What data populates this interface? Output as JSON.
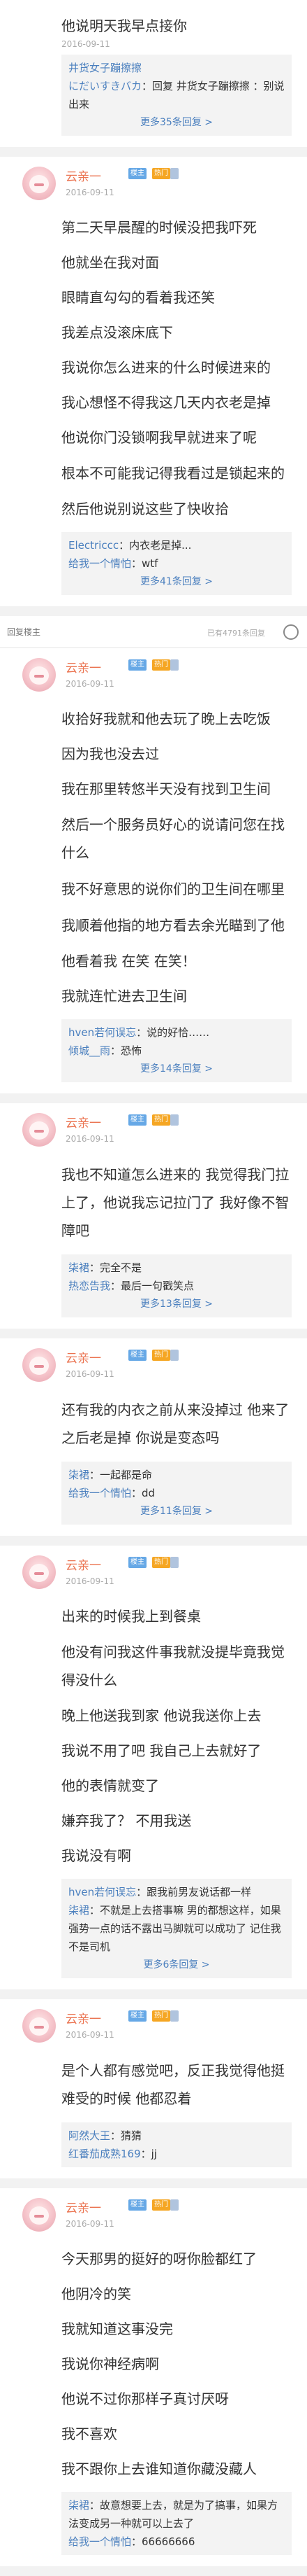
{
  "top": {
    "lines": [
      "他说明天我早点接你"
    ],
    "replies": [
      {
        "name": "井货女子蹦擦擦",
        "text": ""
      },
      {
        "name": "にだいすきバカ",
        "text": "：回复 井货女子蹦擦擦 ：别说出来"
      }
    ],
    "more": "更多35条回复 >"
  },
  "posts": [
    {
      "floor": "",
      "user": "云亲一",
      "badge1": "楼主",
      "badge2": "热门",
      "date": "2016-09-11",
      "lines": [
        "第二天早晨醒的时候没把我吓死",
        "他就坐在我对面",
        "眼睛直勾勾的看着我还笑",
        "我差点没滚床底下",
        "我说你怎么进来的什么时候进来的",
        "我心想怪不得我这几天内衣老是掉",
        "他说你门没锁啊我早就进来了呢",
        "根本不可能我记得我看过是锁起来的",
        "然后他说别说这些了快收拾"
      ],
      "replies": [
        {
          "name": "Electriccc",
          "text": "：内衣老是掉..."
        },
        {
          "name": "给我一个情怕",
          "text": "：wtf"
        }
      ],
      "more": "更多41条回复 >"
    },
    {
      "floor": "",
      "user": "云亲一",
      "badge1": "楼主",
      "badge2": "热门",
      "date": "2016-09-11",
      "lines": [
        "收拾好我就和他去玩了晚上去吃饭",
        "因为我也没去过",
        "我在那里转悠半天没有找到卫生间",
        "然后一个服务员好心的说请问您在找什么",
        "我不好意思的说你们的卫生间在哪里",
        "我顺着他指的地方看去余光瞄到了他",
        "他看着我 在笑 在笑！",
        "我就连忙进去卫生间"
      ],
      "replies": [
        {
          "name": "hven若何误忘",
          "text": "：说的好恰……"
        },
        {
          "name": "倾城__雨",
          "text": "：恐怖"
        }
      ],
      "more": "更多14条回复 >"
    },
    {
      "floor": "",
      "user": "云亲一",
      "badge1": "楼主",
      "badge2": "热门",
      "date": "2016-09-11",
      "lines": [
        "我也不知道怎么进来的 我觉得我门拉上了，他说我忘记拉门了 我好像不智障吧"
      ],
      "replies": [
        {
          "name": "柒裙",
          "text": "：完全不是"
        },
        {
          "name": "热恋告我",
          "text": "：最后一句戳笑点"
        }
      ],
      "more": "更多13条回复 >"
    },
    {
      "floor": "",
      "user": "云亲一",
      "badge1": "楼主",
      "badge2": "热门",
      "date": "2016-09-11",
      "lines": [
        "还有我的内衣之前从来没掉过 他来了之后老是掉 你说是变态吗"
      ],
      "replies": [
        {
          "name": "柒裙",
          "text": "：一起都是命"
        },
        {
          "name": "给我一个情怕",
          "text": "：dd"
        }
      ],
      "more": "更多11条回复 >"
    },
    {
      "floor": "",
      "user": "云亲一",
      "badge1": "楼主",
      "badge2": "热门",
      "date": "2016-09-11",
      "lines": [
        "出来的时候我上到餐桌",
        "他没有问我这件事我就没提毕竟我觉得没什么",
        "晚上他送我到家 他说我送你上去",
        "我说不用了吧 我自己上去就好了",
        "他的表情就变了",
        "嫌弃我了？ 不用我送",
        "我说没有啊"
      ],
      "replies": [
        {
          "name": "hven若何误忘",
          "text": "：跟我前男友说话都一样"
        },
        {
          "name": "柒裙",
          "text": "：不就是上去搭事嘛 男的都想这样，如果强势一点的话不露出马脚就可以成功了 记住我不是司机"
        }
      ],
      "more": "更多6条回复 >"
    },
    {
      "floor": "",
      "user": "云亲一",
      "badge1": "楼主",
      "badge2": "热门",
      "date": "2016-09-11",
      "lines": [
        "是个人都有感觉吧，反正我觉得他挺难受的时候 他都忍着"
      ],
      "replies": [
        {
          "name": "阿然大王",
          "text": "：猜猜"
        },
        {
          "name": "红番茄成熟169",
          "text": "：jj"
        }
      ],
      "more": ""
    },
    {
      "floor": "",
      "user": "云亲一",
      "badge1": "楼主",
      "badge2": "热门",
      "date": "2016-09-11",
      "lines": [
        "今天那男的挺好的呀你脸都红了",
        "他阴冷的笑",
        "我就知道这事没完",
        "我说你神经病啊",
        "他说不过你那样子真讨厌呀",
        "我不喜欢",
        "我不跟你上去谁知道你藏没藏人"
      ],
      "replies": [
        {
          "name": "柒裙",
          "text": "：故意想要上去，就是为了搞事，如果方法变成另一种就可以上去了"
        },
        {
          "name": "给我一个情怕",
          "text": "：66666666"
        }
      ],
      "more": ""
    }
  ],
  "searchbar": {
    "placeholder": "回复楼主",
    "hint": "已有4791条回复"
  }
}
